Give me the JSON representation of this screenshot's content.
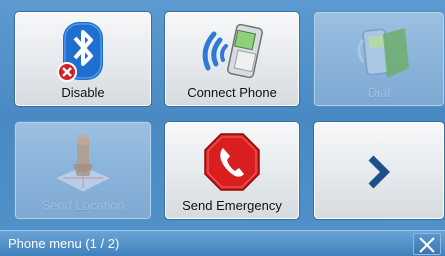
{
  "tiles": [
    {
      "label": "Disable",
      "icon": "bluetooth-disable-icon",
      "enabled": true
    },
    {
      "label": "Connect Phone",
      "icon": "phone-wireless-icon",
      "enabled": true
    },
    {
      "label": "Dial",
      "icon": "phone-dial-icon",
      "enabled": false
    },
    {
      "label": "Send Location",
      "icon": "send-location-icon",
      "enabled": false
    },
    {
      "label": "Send Emergency",
      "icon": "emergency-call-icon",
      "enabled": true
    },
    {
      "label": "",
      "icon": "chevron-right-icon",
      "enabled": true
    }
  ],
  "status_bar": {
    "title": "Phone menu (1 / 2)",
    "close_icon": "close-icon"
  },
  "colors": {
    "background": "#4f8fc7",
    "bluetooth_blue": "#1f6fd0",
    "emergency_red": "#d81e1e",
    "chevron_blue": "#1f4f8a"
  }
}
